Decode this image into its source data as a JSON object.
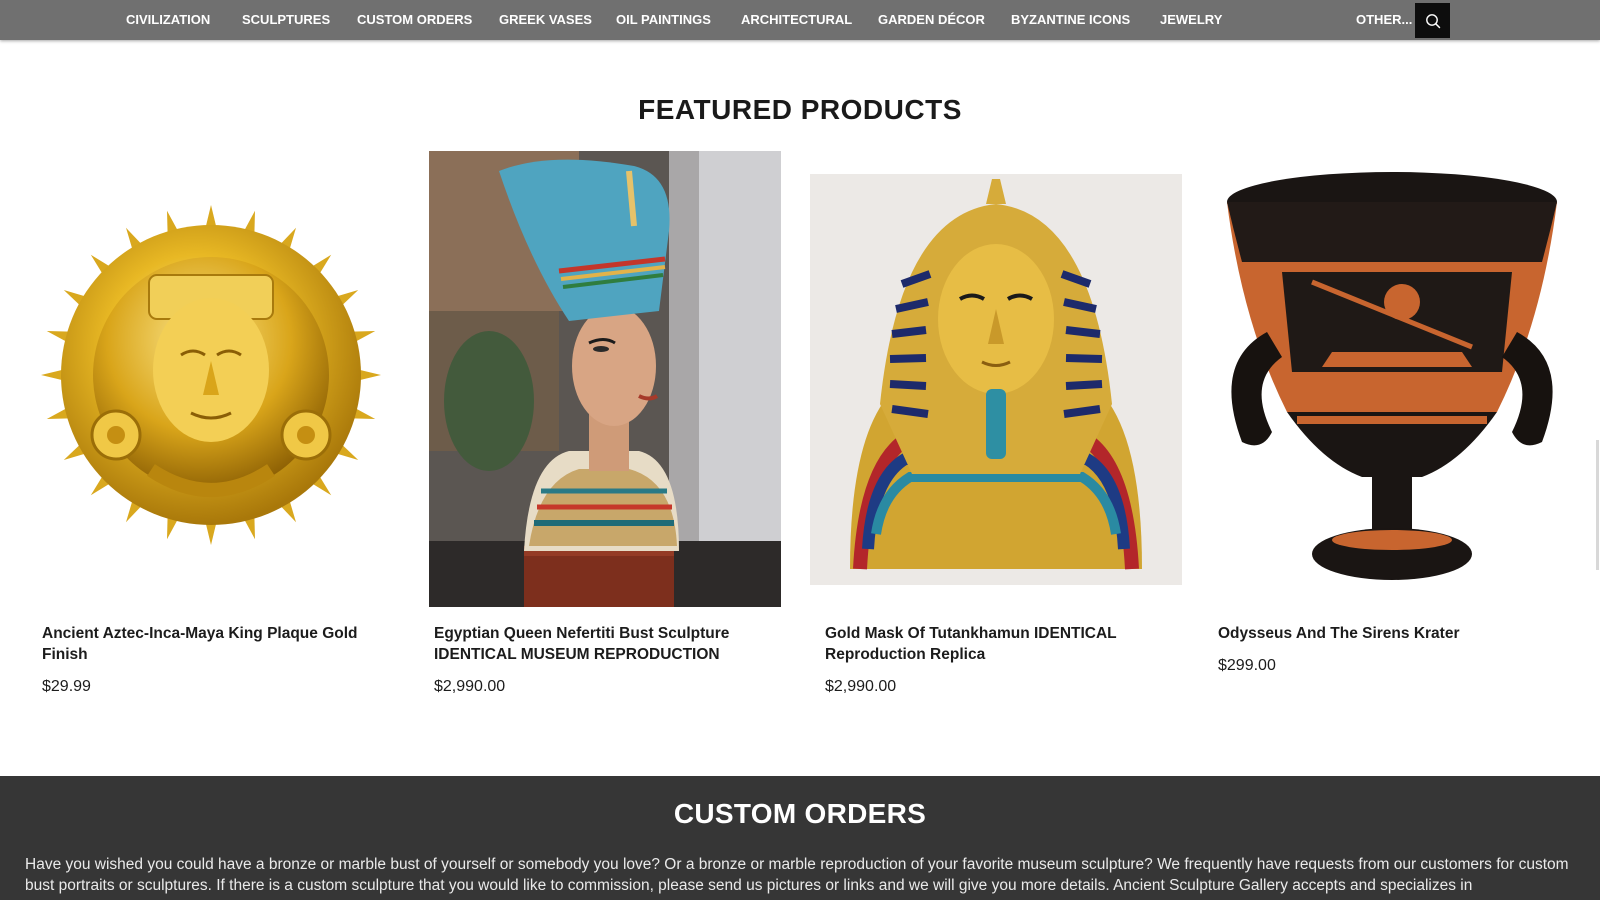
{
  "nav": {
    "items": [
      "CIVILIZATION",
      "SCULPTURES",
      "CUSTOM ORDERS",
      "GREEK VASES",
      "OIL PAINTINGS",
      "ARCHITECTURAL",
      "GARDEN DÉCOR",
      "BYZANTINE ICONS",
      "JEWELRY"
    ],
    "other_label": "OTHER...",
    "search_icon": "search-icon"
  },
  "featured": {
    "title": "FEATURED PRODUCTS",
    "products": [
      {
        "name": "Ancient Aztec-Inca-Maya King Plaque Gold Finish",
        "price": "$29.99"
      },
      {
        "name": "Egyptian Queen Nefertiti Bust Sculpture IDENTICAL MUSEUM REPRODUCTION",
        "price": "$2,990.00"
      },
      {
        "name": "Gold Mask Of Tutankhamun IDENTICAL Reproduction Replica",
        "price": "$2,990.00"
      },
      {
        "name": "Odysseus And The Sirens Krater",
        "price": "$299.00"
      }
    ]
  },
  "custom_orders": {
    "title": "CUSTOM ORDERS",
    "text": "Have you wished you could have a bronze or marble bust of yourself or somebody you love? Or a bronze or marble reproduction of your favorite museum sculpture? We frequently have requests from our customers for custom bust portraits or sculptures. If there is a custom sculpture that you would like to commission, please send us pictures or links and we will give you more details. Ancient Sculpture Gallery accepts and specializes in"
  },
  "colors": {
    "nav_bg": "#707070",
    "footer_bg": "#363636",
    "search_bg": "#0d0d0d"
  }
}
